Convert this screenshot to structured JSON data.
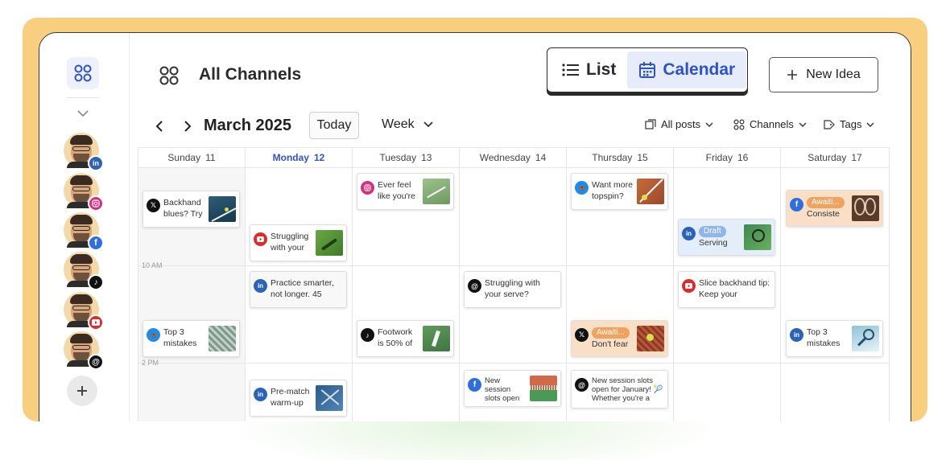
{
  "header": {
    "title": "All Channels",
    "view_list": "List",
    "view_calendar": "Calendar",
    "new_idea": "New Idea"
  },
  "toolbar": {
    "prev": "‹",
    "next": "›",
    "month": "March 2025",
    "today": "Today",
    "range": "Week",
    "filter_posts": "All posts",
    "filter_channels": "Channels",
    "filter_tags": "Tags"
  },
  "sidebar": {
    "channels": [
      {
        "network": "linkedin",
        "color": "#2b63b8"
      },
      {
        "network": "instagram",
        "color": "#d6307c"
      },
      {
        "network": "facebook",
        "color": "#2d6fe0"
      },
      {
        "network": "tiktok",
        "color": "#111111"
      },
      {
        "network": "youtube",
        "color": "#e02a2a"
      },
      {
        "network": "threads",
        "color": "#111111"
      }
    ]
  },
  "days": [
    {
      "name": "Sunday",
      "date": "11"
    },
    {
      "name": "Monday",
      "date": "12"
    },
    {
      "name": "Tuesday",
      "date": "13"
    },
    {
      "name": "Wednesday",
      "date": "14"
    },
    {
      "name": "Thursday",
      "date": "15"
    },
    {
      "name": "Friday",
      "date": "16"
    },
    {
      "name": "Saturday",
      "date": "17"
    }
  ],
  "time_labels": [
    "10 AM",
    "2 PM"
  ],
  "posts": {
    "sun_1": {
      "text": "Backhand blues? Try",
      "network": "x"
    },
    "sun_2": {
      "text": "Top 3 mistakes",
      "network": "bluesky"
    },
    "mon_1": {
      "text": "Struggling with your",
      "network": "youtube"
    },
    "mon_2": {
      "text": "Practice smarter, not longer. 45",
      "network": "linkedin"
    },
    "mon_3": {
      "text": "Pre-match warm-up hack: Don't",
      "network": "linkedin"
    },
    "tue_1": {
      "text": "Ever feel like you're",
      "network": "instagram"
    },
    "tue_2": {
      "text": "Footwork is 50% of",
      "network": "tiktok"
    },
    "wed_1": {
      "text": "Struggling with your serve?",
      "network": "threads"
    },
    "wed_2": {
      "text": "New session slots open",
      "network": "facebook"
    },
    "thu_1": {
      "text": "Want more topspin?",
      "network": "bluesky"
    },
    "thu_2": {
      "status": "Awaiti...",
      "text": "Don't fear",
      "network": "x"
    },
    "thu_3": {
      "text": "New session slots open for January! 🎾 Whether you're a",
      "network": "threads"
    },
    "fri_1": {
      "status": "Draft",
      "text": "Serving",
      "network": "linkedin"
    },
    "fri_2": {
      "text": "Slice backhand tip: Keep your",
      "network": "youtube"
    },
    "sat_1": {
      "status": "Awaiti...",
      "text": "Consiste",
      "network": "facebook"
    },
    "sat_2": {
      "text": "Top 3 mistakes",
      "network": "linkedin"
    }
  },
  "colors": {
    "accent": "#2e52c9",
    "frame": "#f7cf7f",
    "awaiting": "#f0a35e",
    "draft": "#8fb5ee"
  }
}
